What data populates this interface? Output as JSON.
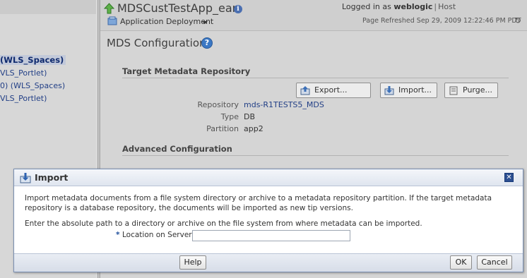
{
  "sidebar": {
    "items": [
      {
        "label": "(WLS_Spaces)",
        "selected": true
      },
      {
        "label": "VLS_Portlet)",
        "selected": false
      },
      {
        "label": "0) (WLS_Spaces)",
        "selected": false
      },
      {
        "label": "VLS_Portlet)",
        "selected": false
      }
    ]
  },
  "header": {
    "app_title": "MDSCustTestApp_ear",
    "menu_label": "Application Deployment",
    "logged_in_prefix": "Logged in as",
    "username": "weblogic",
    "separator": "|",
    "host_label": "Host",
    "refresh_text": "Page Refreshed Sep 29, 2009 12:22:46 PM PDT"
  },
  "page": {
    "heading": "MDS Configuration",
    "help_glyph": "?"
  },
  "target_repo": {
    "section_title": "Target Metadata Repository",
    "buttons": {
      "export": "Export...",
      "import": "Import...",
      "purge": "Purge..."
    },
    "fields": {
      "repository_label": "Repository",
      "repository_value": "mds-R1TESTS5_MDS",
      "type_label": "Type",
      "type_value": "DB",
      "partition_label": "Partition",
      "partition_value": "app2"
    }
  },
  "advanced": {
    "section_title": "Advanced Configuration"
  },
  "dialog": {
    "title": "Import",
    "close_glyph": "✕",
    "description": "Import metadata documents from a file system directory or archive to a metadata repository partition. If the target metadata repository is a database repository, the documents will be imported as new tip versions.",
    "instruction": "Enter the absolute path to a directory or archive on the file system from where metadata can be imported.",
    "required_marker": "*",
    "location_label": "Location on Server",
    "location_value": "",
    "help_button": "Help",
    "ok_button": "OK",
    "cancel_button": "Cancel"
  },
  "colors": {
    "link": "#223f86",
    "dialog_border": "#7a8fb2",
    "close_button": "#2c4f91",
    "help_bubble": "#3b78c4"
  },
  "icons": {
    "up": "up-arrow-icon",
    "info": "info-icon",
    "deployment": "deployment-icon",
    "refresh": "refresh-icon",
    "help": "help-icon",
    "export": "export-icon",
    "import": "import-icon",
    "purge": "purge-icon",
    "close": "close-icon"
  }
}
